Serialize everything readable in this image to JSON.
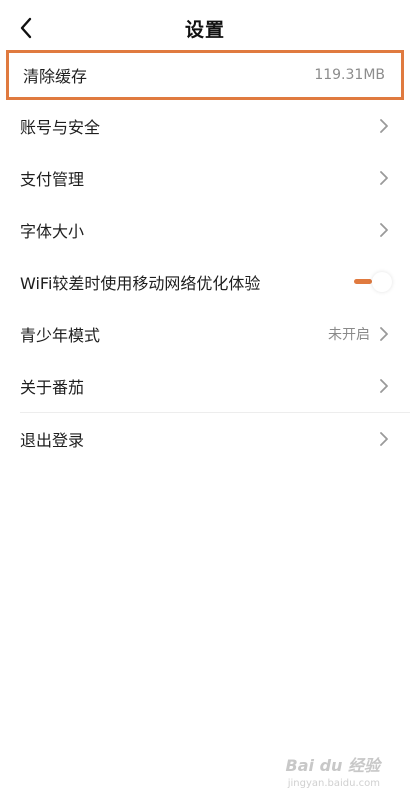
{
  "header": {
    "title": "设置",
    "back_icon": "chevron-left-icon"
  },
  "settings": {
    "clear_cache": {
      "label": "清除缓存",
      "value": "119.31MB"
    },
    "account_security": {
      "label": "账号与安全"
    },
    "payment": {
      "label": "支付管理"
    },
    "font_size": {
      "label": "字体大小"
    },
    "wifi_optimize": {
      "label": "WiFi较差时使用移动网络优化体验",
      "enabled": true
    },
    "teen_mode": {
      "label": "青少年模式",
      "value": "未开启"
    },
    "about": {
      "label": "关于番茄"
    },
    "logout": {
      "label": "退出登录"
    }
  },
  "colors": {
    "accent": "#e07a3f",
    "highlight_border": "#e07a3f"
  },
  "watermark": {
    "brand": "Bai du 经验",
    "url": "jingyan.baidu.com"
  }
}
